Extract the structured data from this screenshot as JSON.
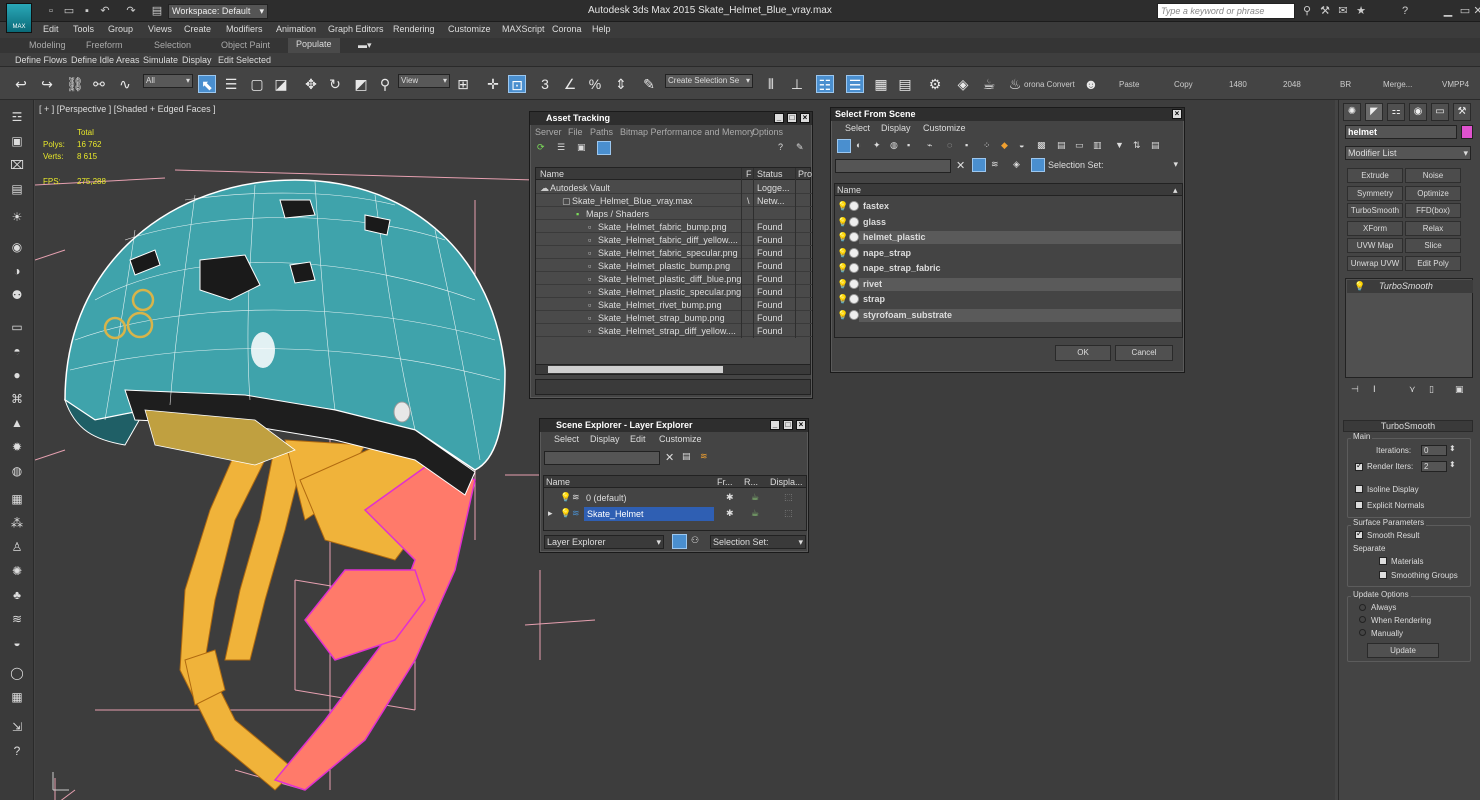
{
  "app": {
    "logo_label": "MAX",
    "title": "Autodesk 3ds Max  2015      Skate_Helmet_Blue_vray.max",
    "workspace": "Workspace: Default",
    "help_placeholder": "Type a keyword or phrase"
  },
  "menu": [
    "Edit",
    "Tools",
    "Group",
    "Views",
    "Create",
    "Modifiers",
    "Animation",
    "Graph Editors",
    "Rendering",
    "Customize",
    "MAXScript",
    "Corona",
    "Help"
  ],
  "ribbon_tabs": [
    "Modeling",
    "Freeform",
    "Selection",
    "Object Paint",
    "Populate"
  ],
  "ribbon_sub": [
    "Define Flows",
    "Define Idle Areas",
    "Simulate",
    "Display",
    "Edit Selected"
  ],
  "toolbar": {
    "filter": "All",
    "refcoord": "View",
    "selection_set": "Create Selection Se",
    "corona_convert": "orona Convert",
    "paste": "Paste",
    "copy": "Copy",
    "v1480": "1480",
    "v2048": "2048",
    "br": "BR",
    "merge": "Merge...",
    "vmpp": "VMPP4"
  },
  "viewport": {
    "label": "[ + ] [Perspective ] [Shaded + Edged Faces ]",
    "total_label": "Total",
    "polys_label": "Polys:",
    "polys": "16 762",
    "verts_label": "Verts:",
    "verts": "8 615",
    "fps_label": "FPS:",
    "fps": "275,288"
  },
  "asset_tracking": {
    "title": "Asset Tracking",
    "menu": [
      "Server",
      "File",
      "Paths",
      "Bitmap Performance and Memory",
      "Options"
    ],
    "columns": [
      "Name",
      "F",
      "Status",
      "Pro"
    ],
    "rows": [
      {
        "name": "Autodesk Vault",
        "status": "Logge..."
      },
      {
        "name": "Skate_Helmet_Blue_vray.max",
        "status": "Netw..."
      },
      {
        "name": "Maps / Shaders",
        "status": ""
      },
      {
        "name": "Skate_Helmet_fabric_bump.png",
        "status": "Found"
      },
      {
        "name": "Skate_Helmet_fabric_diff_yellow....",
        "status": "Found"
      },
      {
        "name": "Skate_Helmet_fabric_specular.png",
        "status": "Found"
      },
      {
        "name": "Skate_Helmet_plastic_bump.png",
        "status": "Found"
      },
      {
        "name": "Skate_Helmet_plastic_diff_blue.png",
        "status": "Found"
      },
      {
        "name": "Skate_Helmet_plastic_specular.png",
        "status": "Found"
      },
      {
        "name": "Skate_Helmet_rivet_bump.png",
        "status": "Found"
      },
      {
        "name": "Skate_Helmet_strap_bump.png",
        "status": "Found"
      },
      {
        "name": "Skate_Helmet_strap_diff_yellow....",
        "status": "Found"
      }
    ],
    "path_flag": "\\"
  },
  "select_from_scene": {
    "title": "Select From Scene",
    "menu": [
      "Select",
      "Display",
      "Customize"
    ],
    "selection_set_label": "Selection Set:",
    "column": "Name",
    "items": [
      {
        "name": "fastex",
        "hl": false
      },
      {
        "name": "glass",
        "hl": false
      },
      {
        "name": "helmet_plastic",
        "hl": true
      },
      {
        "name": "nape_strap",
        "hl": false
      },
      {
        "name": "nape_strap_fabric",
        "hl": false
      },
      {
        "name": "rivet",
        "hl": true
      },
      {
        "name": "strap",
        "hl": false
      },
      {
        "name": "styrofoam_substrate",
        "hl": true
      }
    ],
    "ok": "OK",
    "cancel": "Cancel"
  },
  "scene_explorer": {
    "title": "Scene Explorer - Layer Explorer",
    "menu": [
      "Select",
      "Display",
      "Edit",
      "Customize"
    ],
    "columns": [
      "Name",
      "Fr...",
      "R...",
      "Displa..."
    ],
    "rows": [
      "0 (default)",
      "Skate_Helmet"
    ],
    "footer_left": "Layer Explorer",
    "footer_right": "Selection Set:"
  },
  "command_panel": {
    "object_name": "helmet",
    "modifier_list": "Modifier List",
    "buttons": [
      "Extrude",
      "Noise",
      "Symmetry",
      "Optimize",
      "TurboSmooth",
      "FFD(box)",
      "XForm",
      "Relax",
      "UVW Map",
      "Slice",
      "Unwrap UVW",
      "Edit Poly"
    ],
    "stack_item": "TurboSmooth",
    "rollout": "TurboSmooth",
    "main": "Main",
    "iterations_label": "Iterations:",
    "iterations": "0",
    "render_iters_label": "Render Iters:",
    "render_iters": "2",
    "isoline": "Isoline Display",
    "explicit": "Explicit Normals",
    "surface": "Surface Parameters",
    "smooth_result": "Smooth Result",
    "separate": "Separate",
    "materials": "Materials",
    "smoothing_groups": "Smoothing Groups",
    "update_options": "Update Options",
    "always": "Always",
    "when_rendering": "When Rendering",
    "manually": "Manually",
    "update": "Update"
  },
  "colors": {
    "helmet": "#3fa3ab",
    "strap": "#f0b33a",
    "wire_pink": "#e030d0",
    "wire_white": "#ffffff",
    "accent": "#4a8fcf"
  }
}
